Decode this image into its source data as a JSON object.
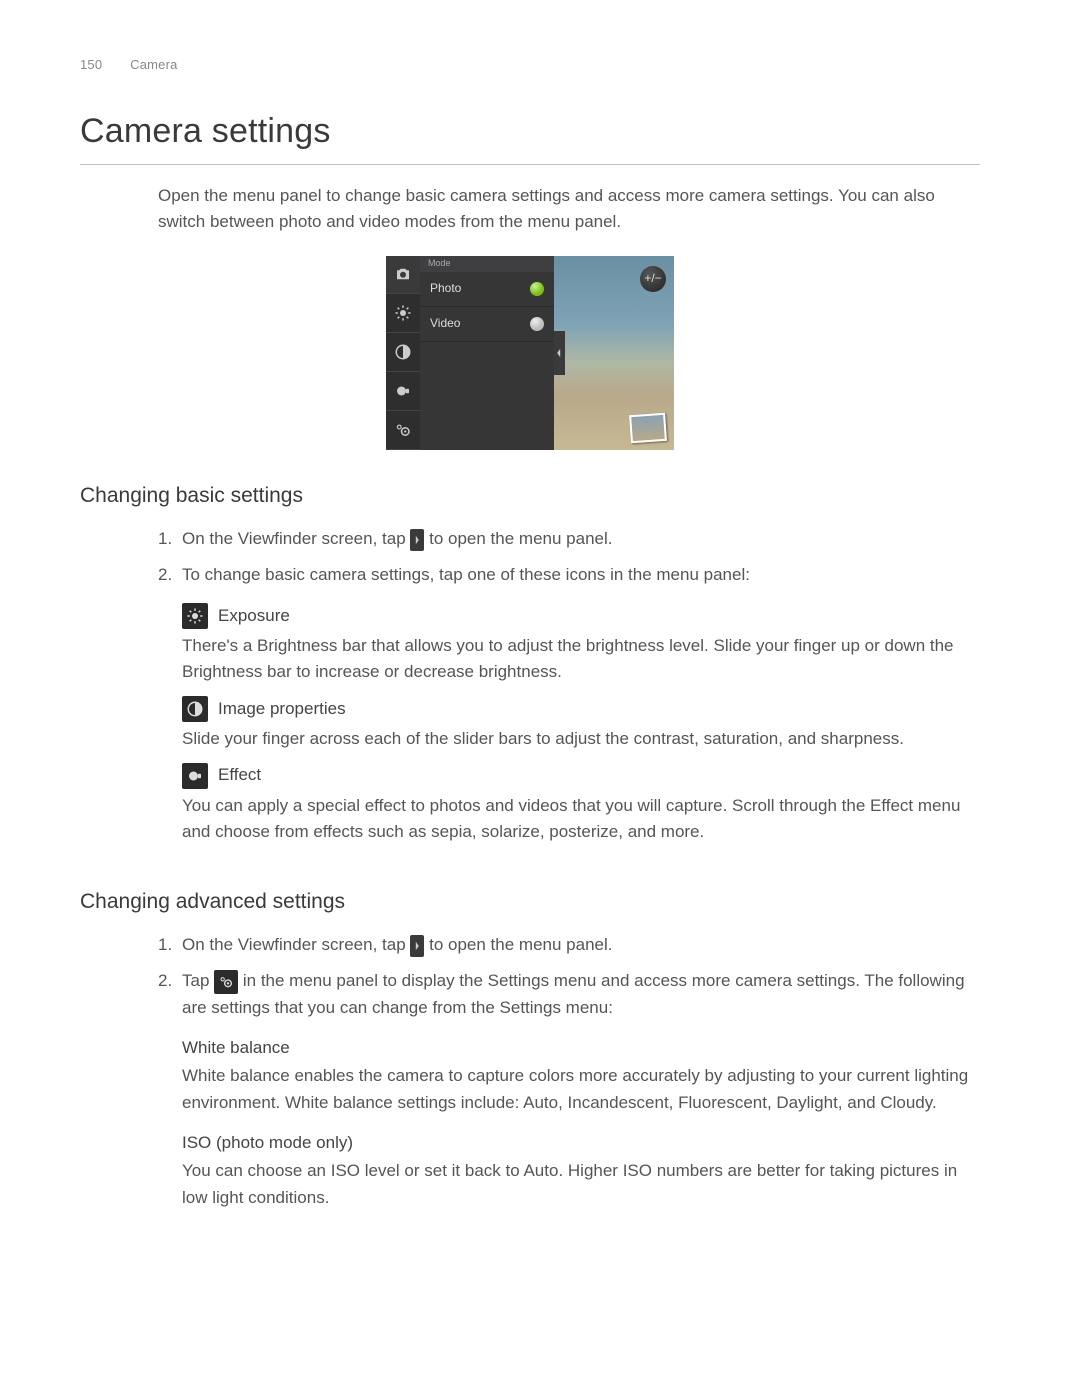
{
  "header": {
    "page_number": "150",
    "section": "Camera"
  },
  "title": "Camera settings",
  "intro": "Open the menu panel to change basic camera settings and access more camera settings. You can also switch between photo and video modes from the menu panel.",
  "camera_mock": {
    "mode_header": "Mode",
    "modes": [
      {
        "label": "Photo",
        "selected": true
      },
      {
        "label": "Video",
        "selected": false
      }
    ],
    "ev_badge": "+/−"
  },
  "section_basic": {
    "heading": "Changing basic settings",
    "step1_a": "On the Viewfinder screen, tap ",
    "step1_b": " to open the menu panel.",
    "step2": "To change basic camera settings, tap one of these icons in the menu panel:",
    "features": [
      {
        "icon": "exposure-icon",
        "label": "Exposure",
        "desc": "There's a Brightness bar that allows you to adjust the brightness level. Slide your finger up or down the Brightness bar to increase or decrease brightness."
      },
      {
        "icon": "image-properties-icon",
        "label": "Image properties",
        "desc": "Slide your finger across each of the slider bars to adjust the contrast, saturation, and sharpness."
      },
      {
        "icon": "effect-icon",
        "label": "Effect",
        "desc": "You can apply a special effect to photos and videos that you will capture. Scroll through the Effect menu and choose from effects such as sepia, solarize, posterize, and more."
      }
    ]
  },
  "section_adv": {
    "heading": "Changing advanced settings",
    "step1_a": "On the Viewfinder screen, tap ",
    "step1_b": " to open the menu panel.",
    "step2_a": "Tap ",
    "step2_b": " in the menu panel to display the Settings menu and access more camera settings. The following are settings that you can change from the Settings menu:",
    "items": [
      {
        "title": "White balance",
        "desc": "White balance enables the camera to capture colors more accurately by adjusting to your current lighting environment. White balance settings include: Auto, Incandescent, Fluorescent, Daylight, and Cloudy."
      },
      {
        "title": "ISO (photo mode only)",
        "desc": "You can choose an ISO level or set it back to Auto. Higher ISO numbers are better for taking pictures in low light conditions."
      }
    ]
  }
}
